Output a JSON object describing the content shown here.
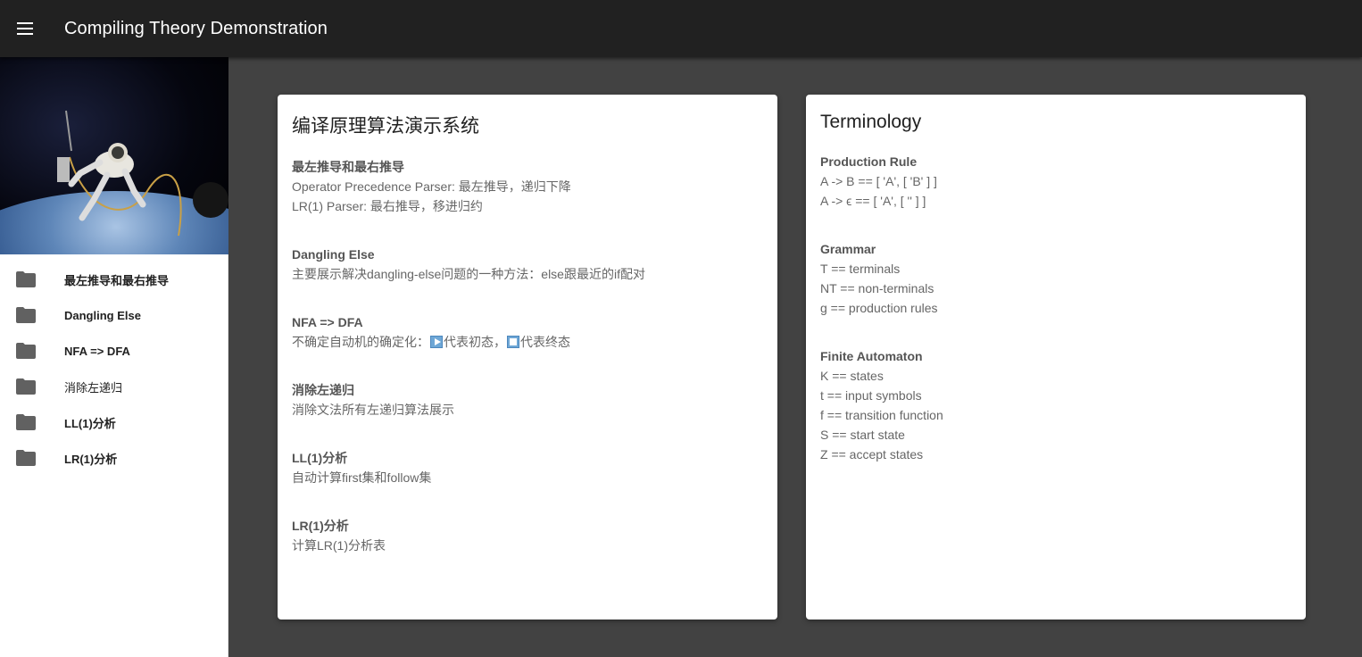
{
  "appbar": {
    "title": "Compiling Theory Demonstration",
    "menu_icon": "hamburger-menu-icon"
  },
  "drawer": {
    "items": [
      {
        "label": "最左推导和最右推导",
        "icon": "folder-icon"
      },
      {
        "label": "Dangling Else",
        "icon": "folder-icon"
      },
      {
        "label": "NFA => DFA",
        "icon": "folder-icon"
      },
      {
        "label": "消除左递归",
        "icon": "folder-icon"
      },
      {
        "label": "LL(1)分析",
        "icon": "folder-icon"
      },
      {
        "label": "LR(1)分析",
        "icon": "folder-icon"
      }
    ]
  },
  "intro_card": {
    "title": "编译原理算法演示系统",
    "sections": [
      {
        "heading": "最左推导和最右推导",
        "lines": [
          "Operator Precedence Parser: 最左推导，递归下降",
          "LR(1) Parser: 最右推导，移进归约"
        ]
      },
      {
        "heading": "Dangling Else",
        "lines": [
          "主要展示解决dangling-else问题的一种方法：else跟最近的if配对"
        ]
      },
      {
        "heading": "NFA => DFA",
        "line_prefix": "不确定自动机的确定化：",
        "start_text": "代表初态，",
        "end_text": "代表终态"
      },
      {
        "heading": "消除左递归",
        "lines": [
          "消除文法所有左递归算法展示"
        ]
      },
      {
        "heading": "LL(1)分析",
        "lines": [
          "自动计算first集和follow集"
        ]
      },
      {
        "heading": "LR(1)分析",
        "lines": [
          "计算LR(1)分析表"
        ]
      }
    ]
  },
  "terminology_card": {
    "title": "Terminology",
    "sections": [
      {
        "heading": "Production Rule",
        "lines": [
          "A -> B == [ 'A', [ 'B' ] ]",
          "A -> ϵ == [ 'A', [ '' ] ]"
        ]
      },
      {
        "heading": "Grammar",
        "lines": [
          "T == terminals",
          "NT == non-terminals",
          "g == production rules"
        ]
      },
      {
        "heading": "Finite Automaton",
        "lines": [
          "K == states",
          "t == input symbols",
          "f == transition function",
          "S == start state",
          "Z == accept states"
        ]
      }
    ]
  }
}
